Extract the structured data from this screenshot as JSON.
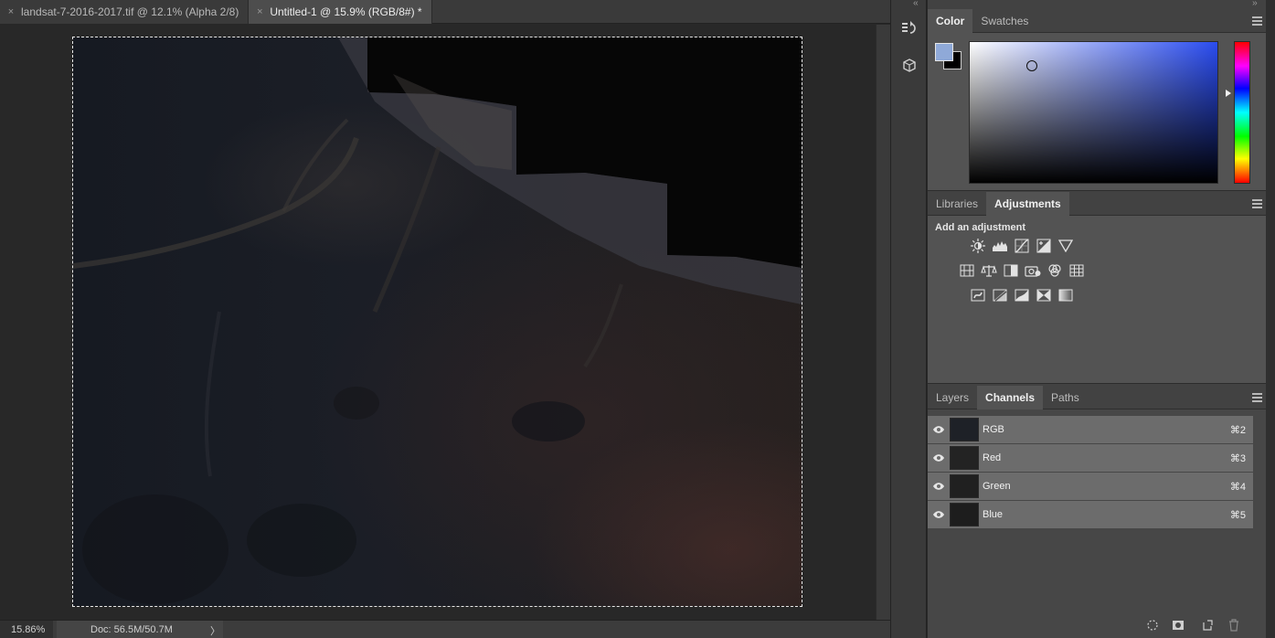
{
  "tabs": [
    {
      "label": "landsat-7-2016-2017.tif @ 12.1% (Alpha 2/8)",
      "close": "×"
    },
    {
      "label": "Untitled-1 @ 15.9% (RGB/8#) *",
      "close": "×"
    }
  ],
  "status": {
    "zoom": "15.86%",
    "doc": "Doc: 56.5M/50.7M",
    "arrow": "〉"
  },
  "tool_strip": {
    "collapse": "‹‹",
    "buttons": [
      "history-icon",
      "3d-icon"
    ]
  },
  "panel_collapse": "››",
  "color_panel": {
    "tabs": [
      "Color",
      "Swatches"
    ],
    "foreground": "#8fa9d8",
    "background": "#000000"
  },
  "adjust_panel": {
    "tabs": [
      "Libraries",
      "Adjustments"
    ],
    "title": "Add an adjustment",
    "rows": [
      [
        "brightness-contrast-icon",
        "levels-icon",
        "curves-icon",
        "exposure-icon",
        "gradient-triangle-icon"
      ],
      [
        "vibrance-icon",
        "color-balance-icon",
        "black-white-icon",
        "photo-filter-icon",
        "channel-mixer-icon",
        "color-lookup-icon"
      ],
      [
        "invert-icon",
        "posterize-icon",
        "threshold-icon",
        "selective-color-icon",
        "gradient-map-icon"
      ]
    ]
  },
  "channels_panel": {
    "tabs": [
      "Layers",
      "Channels",
      "Paths"
    ],
    "channels": [
      {
        "name": "RGB",
        "shortcut": "⌘2"
      },
      {
        "name": "Red",
        "shortcut": "⌘3"
      },
      {
        "name": "Green",
        "shortcut": "⌘4"
      },
      {
        "name": "Blue",
        "shortcut": "⌘5"
      }
    ]
  },
  "colors": {
    "accent": "#8fa9d8",
    "selection": "#e8e8e8"
  }
}
